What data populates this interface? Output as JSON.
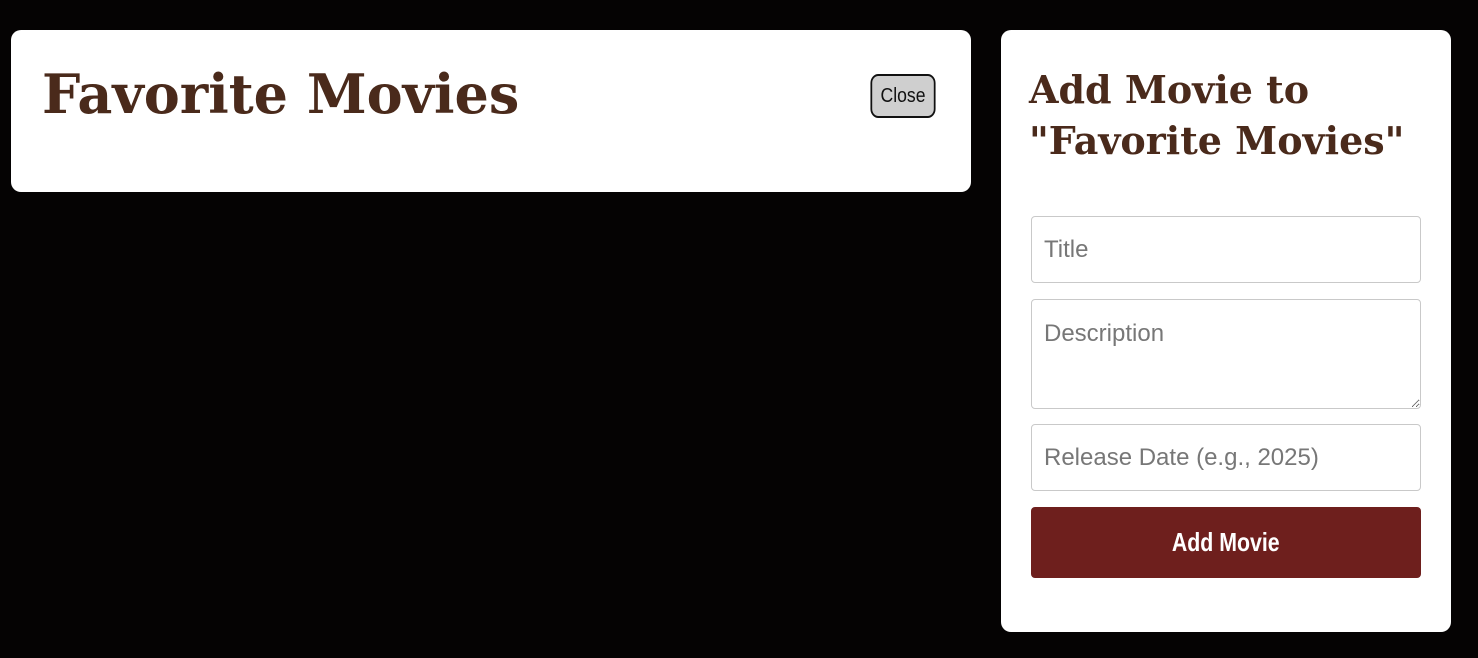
{
  "list": {
    "title": "Favorite Movies",
    "close_label": "Close"
  },
  "form": {
    "title": "Add Movie to \"Favorite Movies\"",
    "title_placeholder": "Title",
    "description_placeholder": "Description",
    "release_date_placeholder": "Release Date (e.g., 2025)",
    "submit_label": "Add Movie"
  },
  "colors": {
    "page_background": "#050303",
    "heading": "#4a2a1b",
    "submit_button": "#6e1f1d",
    "panel": "#ffffff"
  }
}
